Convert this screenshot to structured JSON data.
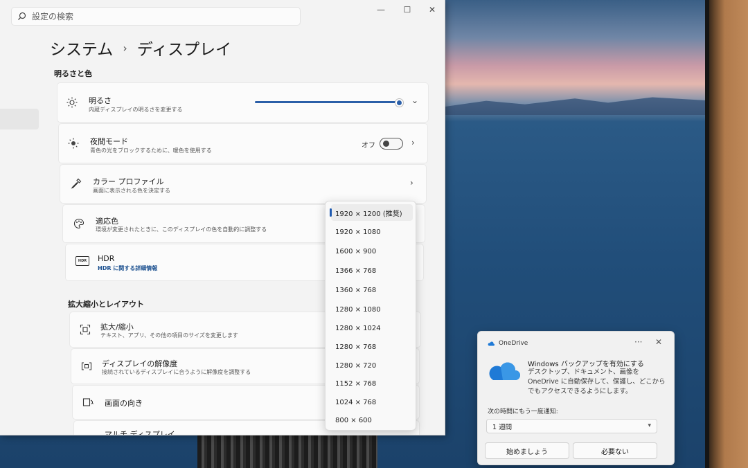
{
  "settings": {
    "search_placeholder": "設定の検索",
    "breadcrumb": {
      "root": "システム",
      "separator": "›",
      "current": "ディスプレイ"
    },
    "window_controls": {
      "minimize": "—",
      "maximize": "☐",
      "close": "✕"
    },
    "section_brightness": "明るさと色",
    "brightness": {
      "title": "明るさ",
      "subtitle": "内蔵ディスプレイの明るさを変更する",
      "level_percent": 100
    },
    "night_mode": {
      "title": "夜間モード",
      "subtitle": "青色の光をブロックするために、暖色を使用する",
      "state": "オフ"
    },
    "color_profile": {
      "title": "カラー プロファイル",
      "subtitle": "画面に表示される色を決定する"
    },
    "adaptive_color": {
      "title": "適応色",
      "subtitle": "環境が変更されたときに、このディスプレイの色を自動的に調整する"
    },
    "hdr": {
      "title": "HDR",
      "link": "HDR に関する詳細情報",
      "icon_text": "HDR"
    },
    "section_layout": "拡大縮小とレイアウト",
    "scale": {
      "title": "拡大/縮小",
      "subtitle": "テキスト、アプリ、その他の項目のサイズを変更します"
    },
    "resolution": {
      "title": "ディスプレイの解像度",
      "subtitle": "接続されているディスプレイに合うように解像度を調整する"
    },
    "orientation": {
      "title": "画面の向き"
    },
    "multi_display": {
      "title": "マルチ ディスプレイ"
    },
    "chevron_right": "›",
    "chevron_down": "⌄"
  },
  "resolution_dropdown": {
    "options": [
      "1920 × 1200 (推奨)",
      "1920 × 1080",
      "1600 × 900",
      "1366 × 768",
      "1360 × 768",
      "1280 × 1080",
      "1280 × 1024",
      "1280 × 768",
      "1280 × 720",
      "1152 × 768",
      "1024 × 768",
      "800 × 600"
    ],
    "selected_index": 0
  },
  "onedrive_toast": {
    "app_name": "OneDrive",
    "more": "···",
    "close": "✕",
    "title": "Windows バックアップを有効にする",
    "body": "デスクトップ、ドキュメント、画像を OneDrive に自動保存して、保護し、どこからでもアクセスできるようにします。",
    "remind_label": "次の時間にもう一度通知:",
    "remind_value": "1 週間",
    "primary_button": "始めましょう",
    "secondary_button": "必要ない"
  },
  "colors": {
    "accent": "#2b5fa8",
    "onedrive_blue": "#1f7ad6"
  }
}
